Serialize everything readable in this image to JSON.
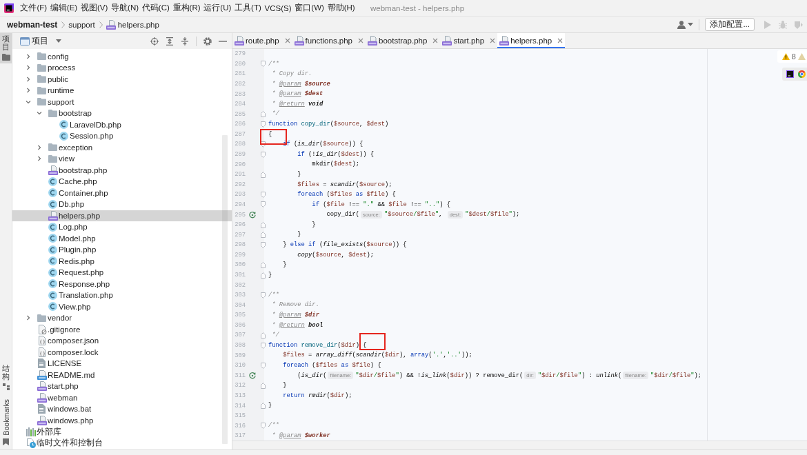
{
  "menu_bar": {
    "items": [
      "文件(F)",
      "编辑(E)",
      "视图(V)",
      "导航(N)",
      "代码(C)",
      "重构(R)",
      "运行(U)",
      "工具(T)",
      "VCS(S)",
      "窗口(W)",
      "帮助(H)"
    ],
    "title": "webman-test - helpers.php"
  },
  "nav_bar": {
    "breadcrumbs": [
      {
        "label": "webman-test",
        "kind": "project"
      },
      {
        "label": "support",
        "kind": "folder"
      },
      {
        "label": "helpers.php",
        "kind": "php"
      }
    ],
    "config_button": "添加配置...",
    "actions": [
      {
        "kind": "run",
        "disabled": true
      },
      {
        "kind": "debug",
        "disabled": true
      },
      {
        "kind": "coverage",
        "disabled": true
      }
    ]
  },
  "tool_stripe": {
    "top": [
      {
        "label": "项目",
        "kind": "project",
        "selected": true
      }
    ],
    "bottom": [
      {
        "label": "结构",
        "kind": "structure",
        "selected": false
      },
      {
        "label": "Bookmarks",
        "kind": "bookmarks",
        "selected": false
      }
    ]
  },
  "project_panel": {
    "title": "项目",
    "tree": [
      {
        "children": [
          {
            "label": "config",
            "kind": "folder",
            "expanded": false,
            "selected": false
          },
          {
            "label": "process",
            "kind": "folder",
            "expanded": false,
            "selected": false
          },
          {
            "label": "public",
            "kind": "folder",
            "expanded": false,
            "selected": false
          },
          {
            "label": "runtime",
            "kind": "folder",
            "expanded": false,
            "selected": false
          },
          {
            "label": "support",
            "kind": "folder",
            "expanded": true,
            "selected": false,
            "children": [
              {
                "label": "bootstrap",
                "kind": "folder",
                "expanded": true,
                "selected": false,
                "children": [
                  {
                    "label": "LaravelDb.php",
                    "kind": "class",
                    "selected": false
                  },
                  {
                    "label": "Session.php",
                    "kind": "class",
                    "selected": false
                  }
                ]
              },
              {
                "label": "exception",
                "kind": "folder",
                "expanded": false,
                "selected": false
              },
              {
                "label": "view",
                "kind": "folder",
                "expanded": false,
                "selected": false
              },
              {
                "label": "bootstrap.php",
                "kind": "php",
                "selected": false
              },
              {
                "label": "Cache.php",
                "kind": "class",
                "selected": false
              },
              {
                "label": "Container.php",
                "kind": "class",
                "selected": false
              },
              {
                "label": "Db.php",
                "kind": "class",
                "selected": false
              },
              {
                "label": "helpers.php",
                "kind": "php",
                "selected": true
              },
              {
                "label": "Log.php",
                "kind": "class",
                "selected": false
              },
              {
                "label": "Model.php",
                "kind": "class",
                "selected": false
              },
              {
                "label": "Plugin.php",
                "kind": "class",
                "selected": false
              },
              {
                "label": "Redis.php",
                "kind": "class",
                "selected": false
              },
              {
                "label": "Request.php",
                "kind": "class",
                "selected": false
              },
              {
                "label": "Response.php",
                "kind": "class",
                "selected": false
              },
              {
                "label": "Translation.php",
                "kind": "class",
                "selected": false
              },
              {
                "label": "View.php",
                "kind": "class",
                "selected": false
              }
            ]
          },
          {
            "label": "vendor",
            "kind": "folder",
            "expanded": false,
            "selected": false
          },
          {
            "label": ".gitignore",
            "kind": "ignore",
            "selected": false
          },
          {
            "label": "composer.json",
            "kind": "json",
            "selected": false
          },
          {
            "label": "composer.lock",
            "kind": "json",
            "selected": false
          },
          {
            "label": "LICENSE",
            "kind": "text",
            "selected": false
          },
          {
            "label": "README.md",
            "kind": "markdown",
            "selected": false
          },
          {
            "label": "start.php",
            "kind": "php",
            "selected": false
          },
          {
            "label": "webman",
            "kind": "php",
            "selected": false
          },
          {
            "label": "windows.bat",
            "kind": "text",
            "selected": false
          },
          {
            "label": "windows.php",
            "kind": "php",
            "selected": false
          }
        ]
      },
      {
        "label": "外部库",
        "kind": "libraries",
        "selected": false
      },
      {
        "label": "临时文件和控制台",
        "kind": "scratches",
        "selected": false
      }
    ]
  },
  "editor": {
    "tabs": [
      {
        "label": "route.php",
        "selected": false
      },
      {
        "label": "functions.php",
        "selected": false
      },
      {
        "label": "bootstrap.php",
        "selected": false
      },
      {
        "label": "start.php",
        "selected": false
      },
      {
        "label": "helpers.php",
        "selected": true
      }
    ],
    "warnings": "8",
    "lines": [
      {
        "number": "279"
      },
      {
        "number": "280",
        "fold_start": true,
        "tokens": [
          {
            "kind": "comment",
            "text": "/**"
          }
        ]
      },
      {
        "number": "281",
        "tokens": [
          {
            "kind": "comment",
            "text": " * Copy dir."
          }
        ]
      },
      {
        "number": "282",
        "tokens": [
          {
            "kind": "comment",
            "text": " * "
          },
          {
            "kind": "doc_tag",
            "text": "@param"
          },
          {
            "kind": "doc_var",
            "text": " $source"
          }
        ]
      },
      {
        "number": "283",
        "tokens": [
          {
            "kind": "comment",
            "text": " * "
          },
          {
            "kind": "doc_tag",
            "text": "@param"
          },
          {
            "kind": "doc_var",
            "text": " $dest"
          }
        ]
      },
      {
        "number": "284",
        "tokens": [
          {
            "kind": "comment",
            "text": " * "
          },
          {
            "kind": "doc_tag",
            "text": "@return"
          },
          {
            "kind": "doc_type",
            "text": " void"
          }
        ]
      },
      {
        "number": "285",
        "fold_end": true,
        "tokens": [
          {
            "kind": "comment",
            "text": " */"
          }
        ]
      },
      {
        "number": "286",
        "fold_start": true,
        "tokens": [
          {
            "kind": "keyword",
            "text": "function"
          },
          {
            "kind": "fn_decl",
            "text": " copy_dir"
          },
          {
            "kind": "plain",
            "text": "("
          },
          {
            "kind": "var",
            "text": "$source"
          },
          {
            "kind": "plain",
            "text": ", "
          },
          {
            "kind": "var",
            "text": "$dest"
          },
          {
            "kind": "plain",
            "text": ")"
          }
        ]
      },
      {
        "number": "287",
        "tokens": [
          {
            "kind": "plain",
            "text": "{"
          }
        ]
      },
      {
        "number": "288",
        "fold_start": true,
        "tokens": [
          {
            "kind": "keyword",
            "text": "    if"
          },
          {
            "kind": "plain",
            "text": " ("
          },
          {
            "kind": "builtin",
            "text": "is_dir"
          },
          {
            "kind": "plain",
            "text": "("
          },
          {
            "kind": "var",
            "text": "$source"
          },
          {
            "kind": "plain",
            "text": ")) {"
          }
        ]
      },
      {
        "number": "289",
        "fold_start": true,
        "tokens": [
          {
            "kind": "keyword",
            "text": "        if"
          },
          {
            "kind": "plain",
            "text": " (!"
          },
          {
            "kind": "builtin",
            "text": "is_dir"
          },
          {
            "kind": "plain",
            "text": "("
          },
          {
            "kind": "var",
            "text": "$dest"
          },
          {
            "kind": "plain",
            "text": ")) {"
          }
        ]
      },
      {
        "number": "290",
        "tokens": [
          {
            "kind": "call",
            "text": "            mkdir"
          },
          {
            "kind": "plain",
            "text": "("
          },
          {
            "kind": "var",
            "text": "$dest"
          },
          {
            "kind": "plain",
            "text": ");"
          }
        ]
      },
      {
        "number": "291",
        "fold_end": true,
        "tokens": [
          {
            "kind": "plain",
            "text": "        }"
          }
        ]
      },
      {
        "number": "292",
        "tokens": [
          {
            "kind": "var",
            "text": "        $files"
          },
          {
            "kind": "plain",
            "text": " = "
          },
          {
            "kind": "builtin",
            "text": "scandir"
          },
          {
            "kind": "plain",
            "text": "("
          },
          {
            "kind": "var",
            "text": "$source"
          },
          {
            "kind": "plain",
            "text": ");"
          }
        ]
      },
      {
        "number": "293",
        "fold_start": true,
        "tokens": [
          {
            "kind": "keyword",
            "text": "        foreach"
          },
          {
            "kind": "plain",
            "text": " ("
          },
          {
            "kind": "var",
            "text": "$files"
          },
          {
            "kind": "keyword",
            "text": " as"
          },
          {
            "kind": "var",
            "text": " $file"
          },
          {
            "kind": "plain",
            "text": ") {"
          }
        ]
      },
      {
        "number": "294",
        "fold_start": true,
        "tokens": [
          {
            "kind": "keyword",
            "text": "            if"
          },
          {
            "kind": "plain",
            "text": " ("
          },
          {
            "kind": "var",
            "text": "$file"
          },
          {
            "kind": "plain",
            "text": " !== "
          },
          {
            "kind": "string",
            "text": "\".\""
          },
          {
            "kind": "plain",
            "text": " && "
          },
          {
            "kind": "var",
            "text": "$file"
          },
          {
            "kind": "plain",
            "text": " !== "
          },
          {
            "kind": "string",
            "text": "\"..\""
          },
          {
            "kind": "plain",
            "text": ") {"
          }
        ]
      },
      {
        "number": "295",
        "recursive_call": true,
        "tokens": [
          {
            "kind": "call",
            "text": "                copy_dir("
          },
          {
            "kind": "hint",
            "text": "source:"
          },
          {
            "kind": "string",
            "text": "\""
          },
          {
            "kind": "var",
            "text": "$source"
          },
          {
            "kind": "string",
            "text": "/"
          },
          {
            "kind": "var",
            "text": "$file"
          },
          {
            "kind": "string",
            "text": "\""
          },
          {
            "kind": "plain",
            "text": ", "
          },
          {
            "kind": "hint",
            "text": "dest:"
          },
          {
            "kind": "string",
            "text": "\""
          },
          {
            "kind": "var",
            "text": "$dest"
          },
          {
            "kind": "string",
            "text": "/"
          },
          {
            "kind": "var",
            "text": "$file"
          },
          {
            "kind": "string",
            "text": "\""
          },
          {
            "kind": "plain",
            "text": ");"
          }
        ]
      },
      {
        "number": "296",
        "fold_end": true,
        "tokens": [
          {
            "kind": "plain",
            "text": "            }"
          }
        ]
      },
      {
        "number": "297",
        "fold_end": true,
        "tokens": [
          {
            "kind": "plain",
            "text": "        }"
          }
        ]
      },
      {
        "number": "298",
        "fold_start": true,
        "tokens": [
          {
            "kind": "plain",
            "text": "    } "
          },
          {
            "kind": "keyword",
            "text": "else if"
          },
          {
            "kind": "plain",
            "text": " ("
          },
          {
            "kind": "builtin",
            "text": "file_exists"
          },
          {
            "kind": "plain",
            "text": "("
          },
          {
            "kind": "var",
            "text": "$source"
          },
          {
            "kind": "plain",
            "text": ")) {"
          }
        ]
      },
      {
        "number": "299",
        "tokens": [
          {
            "kind": "builtin",
            "text": "        copy"
          },
          {
            "kind": "plain",
            "text": "("
          },
          {
            "kind": "var",
            "text": "$source"
          },
          {
            "kind": "plain",
            "text": ", "
          },
          {
            "kind": "var",
            "text": "$dest"
          },
          {
            "kind": "plain",
            "text": ");"
          }
        ]
      },
      {
        "number": "300",
        "fold_end": true,
        "tokens": [
          {
            "kind": "plain",
            "text": "    }"
          }
        ]
      },
      {
        "number": "301",
        "fold_end": true,
        "tokens": [
          {
            "kind": "plain",
            "text": "}"
          }
        ]
      },
      {
        "number": "302"
      },
      {
        "number": "303",
        "fold_start": true,
        "tokens": [
          {
            "kind": "comment",
            "text": "/**"
          }
        ]
      },
      {
        "number": "304",
        "tokens": [
          {
            "kind": "comment",
            "text": " * Remove dir."
          }
        ]
      },
      {
        "number": "305",
        "tokens": [
          {
            "kind": "comment",
            "text": " * "
          },
          {
            "kind": "doc_tag",
            "text": "@param"
          },
          {
            "kind": "doc_var",
            "text": " $dir"
          }
        ]
      },
      {
        "number": "306",
        "tokens": [
          {
            "kind": "comment",
            "text": " * "
          },
          {
            "kind": "doc_tag",
            "text": "@return"
          },
          {
            "kind": "doc_type",
            "text": " bool"
          }
        ]
      },
      {
        "number": "307",
        "fold_end": true,
        "tokens": [
          {
            "kind": "comment",
            "text": " */"
          }
        ]
      },
      {
        "number": "308",
        "fold_start": true,
        "tokens": [
          {
            "kind": "keyword",
            "text": "function"
          },
          {
            "kind": "fn_decl",
            "text": " remove_dir"
          },
          {
            "kind": "plain",
            "text": "("
          },
          {
            "kind": "var",
            "text": "$dir"
          },
          {
            "kind": "plain",
            "text": ") {"
          }
        ]
      },
      {
        "number": "309",
        "tokens": [
          {
            "kind": "var",
            "text": "    $files"
          },
          {
            "kind": "plain",
            "text": " = "
          },
          {
            "kind": "builtin",
            "text": "array_diff"
          },
          {
            "kind": "plain",
            "text": "("
          },
          {
            "kind": "builtin",
            "text": "scandir"
          },
          {
            "kind": "plain",
            "text": "("
          },
          {
            "kind": "var",
            "text": "$dir"
          },
          {
            "kind": "plain",
            "text": "), "
          },
          {
            "kind": "keyword",
            "text": "array"
          },
          {
            "kind": "plain",
            "text": "("
          },
          {
            "kind": "string",
            "text": "'.'"
          },
          {
            "kind": "plain",
            "text": ","
          },
          {
            "kind": "string",
            "text": "'..'"
          },
          {
            "kind": "plain",
            "text": "));"
          }
        ]
      },
      {
        "number": "310",
        "fold_start": true,
        "tokens": [
          {
            "kind": "keyword",
            "text": "    foreach"
          },
          {
            "kind": "plain",
            "text": " ("
          },
          {
            "kind": "var",
            "text": "$files"
          },
          {
            "kind": "keyword",
            "text": " as"
          },
          {
            "kind": "var",
            "text": " $file"
          },
          {
            "kind": "plain",
            "text": ") {"
          }
        ]
      },
      {
        "number": "311",
        "recursive_call": true,
        "tokens": [
          {
            "kind": "plain",
            "text": "        ("
          },
          {
            "kind": "builtin",
            "text": "is_dir"
          },
          {
            "kind": "plain",
            "text": "("
          },
          {
            "kind": "hint",
            "text": "filename:"
          },
          {
            "kind": "string",
            "text": "\""
          },
          {
            "kind": "var",
            "text": "$dir"
          },
          {
            "kind": "string",
            "text": "/"
          },
          {
            "kind": "var",
            "text": "$file"
          },
          {
            "kind": "string",
            "text": "\""
          },
          {
            "kind": "plain",
            "text": ") && !"
          },
          {
            "kind": "builtin",
            "text": "is_link"
          },
          {
            "kind": "plain",
            "text": "("
          },
          {
            "kind": "var",
            "text": "$dir"
          },
          {
            "kind": "plain",
            "text": ")) ? "
          },
          {
            "kind": "call",
            "text": "remove_dir("
          },
          {
            "kind": "hint",
            "text": "dir:"
          },
          {
            "kind": "string",
            "text": "\""
          },
          {
            "kind": "var",
            "text": "$dir"
          },
          {
            "kind": "string",
            "text": "/"
          },
          {
            "kind": "var",
            "text": "$file"
          },
          {
            "kind": "string",
            "text": "\""
          },
          {
            "kind": "plain",
            "text": ") : "
          },
          {
            "kind": "builtin",
            "text": "unlink"
          },
          {
            "kind": "plain",
            "text": "("
          },
          {
            "kind": "hint",
            "text": "filename:"
          },
          {
            "kind": "string",
            "text": "\""
          },
          {
            "kind": "var",
            "text": "$dir"
          },
          {
            "kind": "string",
            "text": "/"
          },
          {
            "kind": "var",
            "text": "$file"
          },
          {
            "kind": "string",
            "text": "\""
          },
          {
            "kind": "plain",
            "text": ");"
          }
        ]
      },
      {
        "number": "312",
        "fold_end": true,
        "tokens": [
          {
            "kind": "plain",
            "text": "    }"
          }
        ]
      },
      {
        "number": "313",
        "tokens": [
          {
            "kind": "keyword",
            "text": "    return"
          },
          {
            "kind": "builtin",
            "text": " rmdir"
          },
          {
            "kind": "plain",
            "text": "("
          },
          {
            "kind": "var",
            "text": "$dir"
          },
          {
            "kind": "plain",
            "text": ");"
          }
        ]
      },
      {
        "number": "314",
        "fold_end": true,
        "tokens": [
          {
            "kind": "plain",
            "text": "}"
          }
        ]
      },
      {
        "number": "315"
      },
      {
        "number": "316",
        "fold_start": true,
        "tokens": [
          {
            "kind": "comment",
            "text": "/**"
          }
        ]
      },
      {
        "number": "317",
        "tokens": [
          {
            "kind": "comment",
            "text": " * "
          },
          {
            "kind": "doc_tag",
            "text": "@param"
          },
          {
            "kind": "doc_var",
            "text": " $worker"
          }
        ]
      }
    ]
  }
}
